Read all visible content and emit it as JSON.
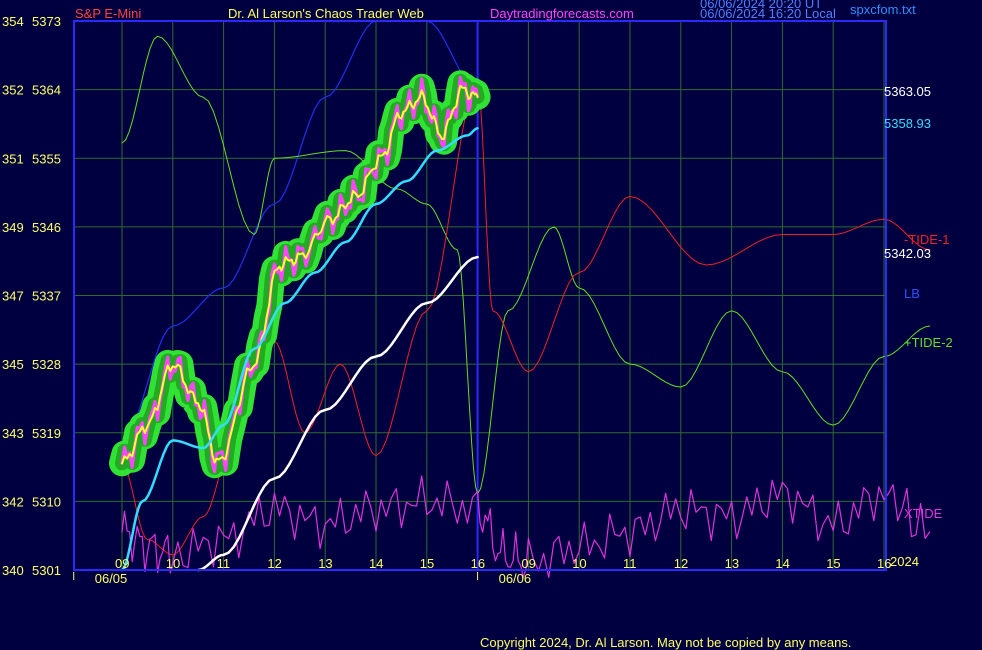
{
  "header": {
    "symbol": "S&P E-Mini",
    "title": "Dr. Al Larson's Chaos Trader Web",
    "site": "Daytradingforecasts.com",
    "utc_time": "06/06/2024 20:20 UT",
    "local_time": "06/06/2024 16:20 Local",
    "file": "spxcfom.txt"
  },
  "colors": {
    "background": "#000040",
    "frame": "#2a2aff",
    "grid": "#2e6b2e",
    "axis_text": "#ffff66",
    "symbol": "#ff4040",
    "title": "#ffff66",
    "site": "#ff44ff",
    "timestamp": "#4f7fff",
    "file": "#2f8fff",
    "price": "#ffff33",
    "glow": "#33ee33",
    "bars": "#ff44ff",
    "ma_cyan": "#33ddff",
    "white_line": "#ffffff",
    "tide1": "#ee2222",
    "lb": "#1f2fee",
    "tide2": "#66dd22",
    "xtide": "#dd33dd"
  },
  "copyright": "Copyright 2024, Dr. Al Larson. May not be copied by any means.",
  "chart_data": {
    "type": "line",
    "left_axis": [
      {
        "degrees": "354",
        "price": "5373"
      },
      {
        "degrees": "352",
        "price": "5364"
      },
      {
        "degrees": "351",
        "price": "5355"
      },
      {
        "degrees": "349",
        "price": "5346"
      },
      {
        "degrees": "347",
        "price": "5337"
      },
      {
        "degrees": "345",
        "price": "5328"
      },
      {
        "degrees": "343",
        "price": "5319"
      },
      {
        "degrees": "342",
        "price": "5310"
      },
      {
        "degrees": "340",
        "price": "5301"
      }
    ],
    "ylim": [
      5301,
      5373
    ],
    "x_ticks": [
      "09",
      "10",
      "11",
      "12",
      "13",
      "14",
      "15",
      "16",
      "09",
      "10",
      "11",
      "12",
      "13",
      "14",
      "15",
      "16"
    ],
    "date_labels": [
      "06/05",
      "06/06"
    ],
    "year_label": "2024",
    "right_labels": {
      "price_high": "5363.05",
      "cyan_value": "5358.93",
      "tide1": "-TIDE-1",
      "white_value": "5342.03",
      "lb": "LB",
      "tide2": "+TIDE-2",
      "xtide": "XTIDE"
    },
    "series": [
      {
        "name": "S&P E-Mini",
        "x": [
          0.0,
          0.5,
          1.0,
          1.5,
          1.9,
          2.6,
          3.1,
          3.5,
          4.1,
          4.6,
          5.1,
          5.5,
          5.9,
          6.3,
          6.7,
          7.0
        ],
        "values": [
          5315,
          5320,
          5328,
          5323,
          5315,
          5328,
          5341,
          5342,
          5347,
          5350,
          5355,
          5361,
          5363,
          5358,
          5364,
          5363.05
        ]
      },
      {
        "name": "cyan",
        "x": [
          0.0,
          0.4,
          1.0,
          1.6,
          2.0,
          2.6,
          3.2,
          3.8,
          4.4,
          5.0,
          5.6,
          6.2,
          6.8,
          7.0
        ],
        "values": [
          5301,
          5310,
          5318,
          5317,
          5320,
          5330,
          5336,
          5340,
          5344,
          5349,
          5352,
          5356,
          5358,
          5358.93
        ]
      },
      {
        "name": "white",
        "x": [
          1.5,
          2.0,
          3.0,
          4.0,
          5.0,
          6.0,
          7.0
        ],
        "values": [
          5301,
          5303,
          5313,
          5322,
          5329,
          5336,
          5342.03
        ]
      },
      {
        "name": "-TIDE-1",
        "x": [
          0.0,
          0.5,
          1.0,
          1.6,
          2.2,
          3.0,
          3.6,
          4.3,
          5.0,
          6.0,
          7.0,
          7.3,
          8.0,
          9.0,
          10.0,
          11.5,
          13.0,
          14.0,
          15.0,
          15.9
        ],
        "values": [
          5315,
          5305,
          5303,
          5308,
          5318,
          5331,
          5319,
          5328,
          5316,
          5335,
          5365,
          5335,
          5327,
          5340,
          5350,
          5341,
          5345,
          5345,
          5347,
          5343
        ]
      },
      {
        "name": "LB",
        "x": [
          0.0,
          1.0,
          2.0,
          3.0,
          4.0,
          5.0,
          6.0,
          7.0
        ],
        "values": [
          5318,
          5333,
          5338,
          5349,
          5363,
          5373,
          5373,
          5364
        ]
      },
      {
        "name": "+TIDE-2",
        "x": [
          0.0,
          0.7,
          1.6,
          2.6,
          3.0,
          4.4,
          5.4,
          6.0,
          6.6,
          7.0,
          7.6,
          8.5,
          9.0,
          10.0,
          11.0,
          12.0,
          13.0,
          14.0,
          15.0,
          15.9
        ],
        "values": [
          5357,
          5371,
          5363,
          5345,
          5355,
          5356,
          5351,
          5349,
          5343,
          5311,
          5335,
          5346,
          5338,
          5328,
          5325,
          5335,
          5327,
          5320,
          5329,
          5333
        ]
      },
      {
        "name": "XTIDE",
        "x": [
          0.0,
          0.5,
          1.0,
          2.0,
          3.0,
          4.0,
          5.0,
          6.0,
          7.0,
          7.5,
          8.0,
          9.0,
          10.0,
          11.0,
          12.0,
          13.0,
          14.0,
          15.0,
          15.9
        ],
        "values": [
          5306,
          5304,
          5303,
          5305,
          5309,
          5307,
          5309,
          5310,
          5309,
          5303,
          5302,
          5304,
          5306,
          5309,
          5308,
          5311,
          5307,
          5311,
          5306
        ]
      }
    ]
  }
}
